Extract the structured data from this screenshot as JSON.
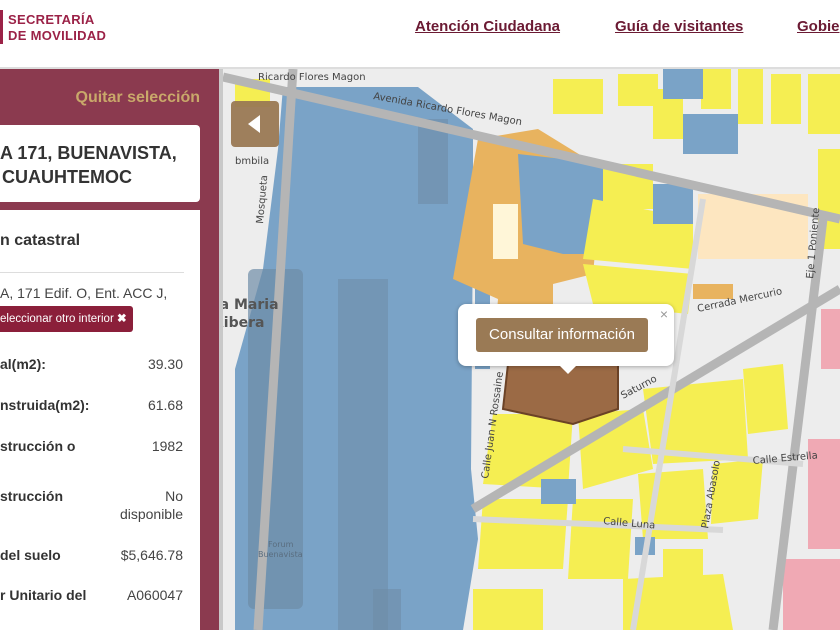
{
  "header": {
    "logo_line1": "SECRETARÍA",
    "logo_line2": "DE MOVILIDAD",
    "nav": [
      "Atención Ciudadana",
      "Guía de visitantes",
      "Gobie"
    ]
  },
  "sidebar": {
    "clear_label": "Quitar selección",
    "address_line1": "A 171, BUENAVISTA,",
    "address_line2": "CUAUHTEMOC",
    "card_title": "n catastral",
    "card_address": "A, 171 Edif. O, Ent. ACC J,",
    "select_interior_label": "eleccionar otro interior",
    "rows": [
      {
        "label": "al(m2):",
        "value": "39.30"
      },
      {
        "label": "nstruida(m2):",
        "value": "61.68"
      },
      {
        "label": "strucción o",
        "value": "1982"
      },
      {
        "label": "strucción",
        "value": "No disponible"
      },
      {
        "label": "del suelo",
        "value": "$5,646.78"
      },
      {
        "label": "r Unitario del",
        "value": "A060047"
      }
    ]
  },
  "map": {
    "labels": {
      "flores_magon_top": "Ricardo Flores Magon",
      "av_flores_magon": "Avenida Ricardo Flores Magon",
      "mosqueta": "Mosqueta",
      "santa_maria": "nta Maria",
      "ribera": "Ribera",
      "cerrada_mercurio": "Cerrada Mercurio",
      "saturno": "Saturno",
      "juan_rossaine": "Calle Juan N Rossaine",
      "calle_estrella": "Calle Estrella",
      "calle_luna": "Calle Luna",
      "plaza_abasolo": "Plaza Abasolo",
      "eje_poniente": "Eje 1 Poniente",
      "forum": "Forum",
      "buenavista": "Buenavista",
      "bmbila": "bmbila"
    },
    "popup": {
      "button_label": "Consultar información",
      "close_label": "×"
    },
    "colors": {
      "blue": "#7aa3c7",
      "yellow": "#f5ee52",
      "orange": "#e8b35f",
      "selected": "#9b6a45",
      "pink": "#f0a9b4"
    }
  }
}
